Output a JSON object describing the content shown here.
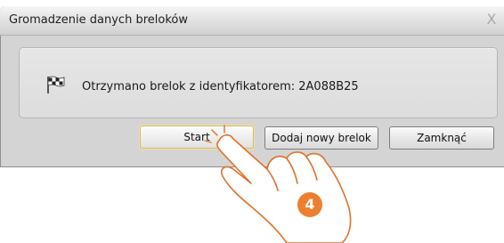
{
  "dialog": {
    "title": "Gromadzenie danych breloków",
    "close_glyph": "X",
    "message": "Otrzymano brelok z identyfikatorem: 2A088B25",
    "message_icon": "checkered-flag-icon"
  },
  "buttons": {
    "start_label": "Start",
    "add_label": "Dodaj nowy brelok",
    "close_label": "Zamknąć"
  },
  "annotation": {
    "step_number": "4",
    "badge_color": "#ee7f2d",
    "pointer": "hand-pointer-icon"
  }
}
